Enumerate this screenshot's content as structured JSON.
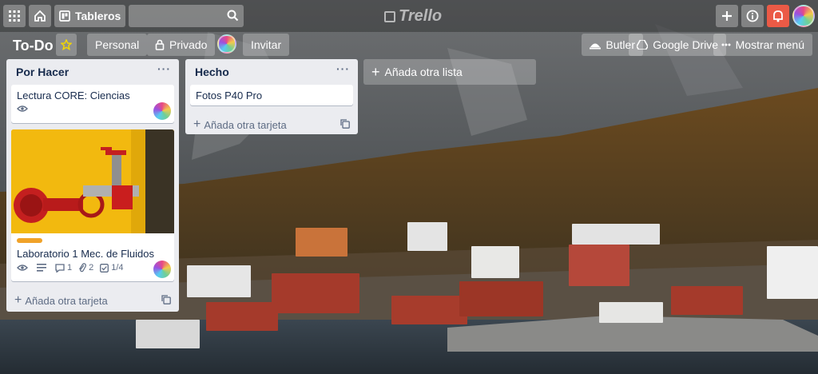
{
  "header": {
    "boards_label": "Tableros",
    "search_placeholder": "",
    "logo_text": "Trello"
  },
  "board": {
    "title": "To-Do",
    "visibility_team": "Personal",
    "visibility_privacy": "Privado",
    "invite_label": "Invitar",
    "butler_label": "Butler",
    "gdrive_label": "Google Drive",
    "menu_label": "Mostrar menú"
  },
  "lists": [
    {
      "title": "Por Hacer",
      "cards": [
        {
          "title": "Lectura CORE: Ciencias"
        },
        {
          "title": "Laboratorio 1 Mec. de Fluidos",
          "comments": "1",
          "attachments": "2",
          "checklist": "1/4"
        }
      ],
      "add_card_label": "Añada otra tarjeta"
    },
    {
      "title": "Hecho",
      "cards": [
        {
          "title": "Fotos P40 Pro"
        }
      ],
      "add_card_label": "Añada otra tarjeta"
    }
  ],
  "add_list_label": "Añada otra lista",
  "colors": {
    "accent_red": "#eb5a46",
    "label_orange": "#f0a229",
    "list_bg": "#ebecf0"
  }
}
